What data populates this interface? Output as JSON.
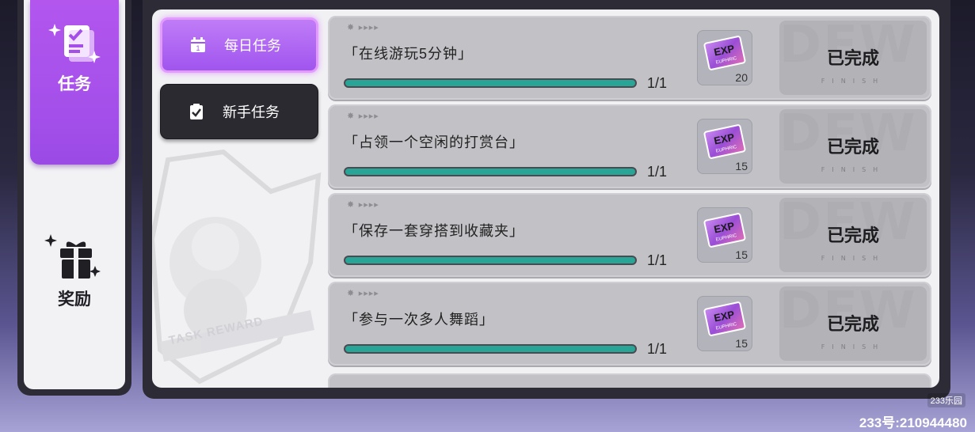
{
  "sidebar": {
    "items": [
      {
        "label": "任务",
        "icon": "task-clipboard-icon",
        "active": true
      },
      {
        "label": "奖励",
        "icon": "gift-icon",
        "active": false
      }
    ]
  },
  "tabs": [
    {
      "label": "每日任务",
      "icon": "calendar-icon",
      "active": true
    },
    {
      "label": "新手任务",
      "icon": "clipboard-check-icon",
      "active": false
    }
  ],
  "emblem": {
    "text": "TASK REWARD"
  },
  "tasks": [
    {
      "name": "「在线游玩5分钟」",
      "stars": "✸ ▸▸▸▸",
      "progress_text": "1/1",
      "progress": 1.0,
      "reward_label": "EXP",
      "reward_sub": "EUPHRIC",
      "reward_count": "20",
      "status": "已完成",
      "status_sub": "FINISH",
      "status_bg": "DEW"
    },
    {
      "name": "「占领一个空闲的打赏台」",
      "stars": "✸ ▸▸▸▸",
      "progress_text": "1/1",
      "progress": 1.0,
      "reward_label": "EXP",
      "reward_sub": "EUPHRIC",
      "reward_count": "15",
      "status": "已完成",
      "status_sub": "FINISH",
      "status_bg": "DEW"
    },
    {
      "name": "「保存一套穿搭到收藏夹」",
      "stars": "✸ ▸▸▸▸",
      "progress_text": "1/1",
      "progress": 1.0,
      "reward_label": "EXP",
      "reward_sub": "EUPHRIC",
      "reward_count": "15",
      "status": "已完成",
      "status_sub": "FINISH",
      "status_bg": "DEW"
    },
    {
      "name": "「参与一次多人舞蹈」",
      "stars": "✸ ▸▸▸▸",
      "progress_text": "1/1",
      "progress": 1.0,
      "reward_label": "EXP",
      "reward_sub": "EUPHRIC",
      "reward_count": "15",
      "status": "已完成",
      "status_sub": "FINISH",
      "status_bg": "DEW"
    }
  ],
  "colors": {
    "accent": "#a44fea",
    "progress": "#28a596",
    "card": "#c2c2c6"
  },
  "watermark": {
    "brand": "233乐园",
    "id": "233号:210944480"
  }
}
